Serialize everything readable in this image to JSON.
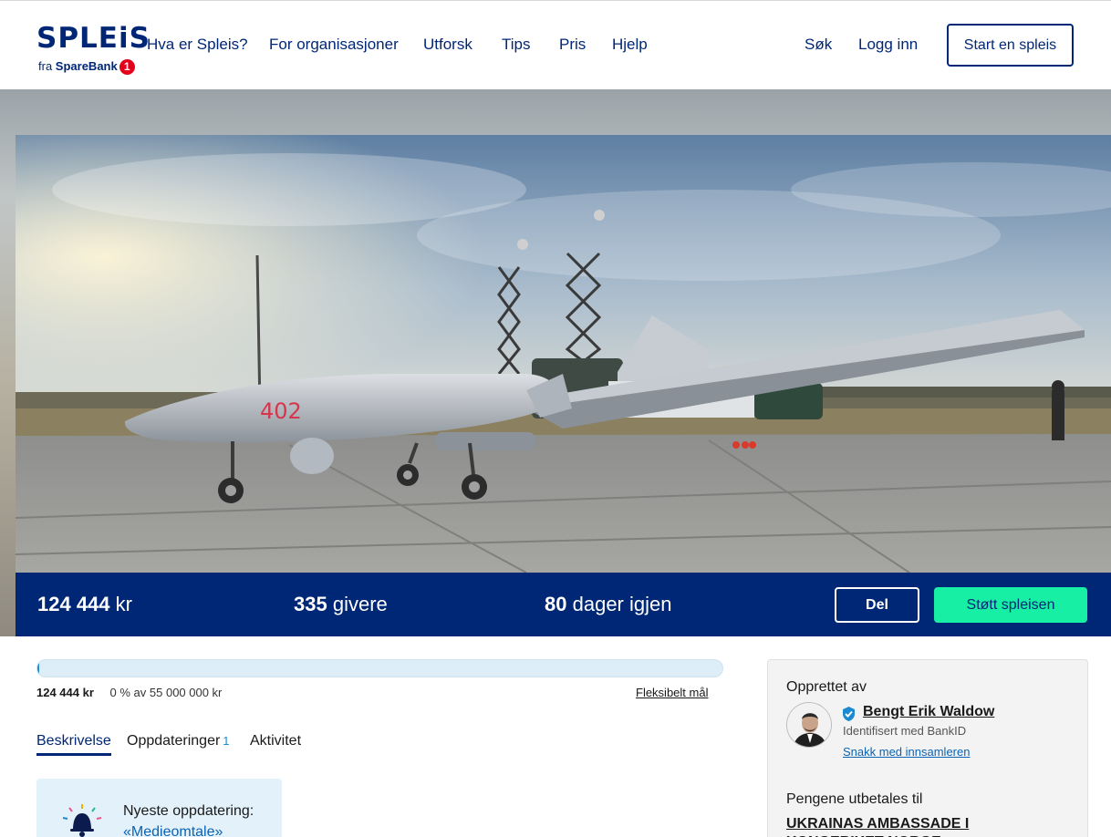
{
  "header": {
    "logo_word": "SPLEiS",
    "logo_sub_prefix": "fra",
    "logo_sub_brand": "SpareBank",
    "logo_sub_badge": "1",
    "nav": [
      "Hva er Spleis?",
      "For organisasjoner",
      "Utforsk",
      "Tips",
      "Pris",
      "Hjelp"
    ],
    "search_label": "Søk",
    "login_label": "Logg inn",
    "start_label": "Start en spleis"
  },
  "hero": {
    "drone_number": "402",
    "image_subject": "drone-on-airfield"
  },
  "stats": {
    "amount_value": "124 444",
    "amount_unit": "kr",
    "givers_value": "335",
    "givers_unit": "givere",
    "days_value": "80",
    "days_unit": "dager igjen",
    "share_label": "Del",
    "support_label": "Støtt spleisen"
  },
  "progress": {
    "fraction": 0.0023,
    "raised": "124 444 kr",
    "of_goal": "0 % av 55 000 000 kr",
    "flexible_label": "Fleksibelt mål"
  },
  "tabs": {
    "description": "Beskrivelse",
    "updates": "Oppdateringer",
    "updates_count": "1",
    "activity": "Aktivitet"
  },
  "update_card": {
    "title": "Nyeste oppdatering:",
    "link": "«Medieomtale»",
    "icon": "bell-icon"
  },
  "sidebar": {
    "created_by": "Opprettet av",
    "creator_name": "Bengt Erik Waldow",
    "identified": "Identifisert med BankID",
    "contact": "Snakk med innsamleren",
    "payout_head": "Pengene utbetales til",
    "payout_name": "UKRAINAS AMBASSADE I KONGERIKET NORGE"
  },
  "colors": {
    "brand_navy": "#002776",
    "support_green": "#17f0a4",
    "link_blue": "#0a63b5",
    "progress_track": "#ddeef8"
  }
}
